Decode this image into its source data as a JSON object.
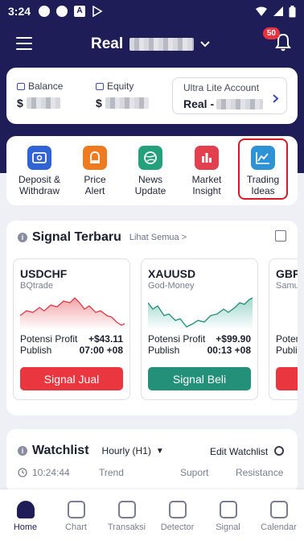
{
  "status_bar": {
    "time": "3:24"
  },
  "header": {
    "account_type": "Real",
    "notification_count": "50"
  },
  "balance": {
    "balance_label": "Balance",
    "balance_currency": "$",
    "equity_label": "Equity",
    "equity_currency": "$",
    "account_box_title": "Ultra Lite Account",
    "account_box_value": "Real -"
  },
  "menu": [
    {
      "label1": "Deposit &",
      "label2": "Withdraw",
      "icon": "wallet-icon",
      "color": "#2f63d6"
    },
    {
      "label1": "Price",
      "label2": "Alert",
      "icon": "alarm-icon",
      "color": "#f07a1f"
    },
    {
      "label1": "News",
      "label2": "Update",
      "icon": "globe-icon",
      "color": "#24a07a"
    },
    {
      "label1": "Market",
      "label2": "Insight",
      "icon": "bar-chart-icon",
      "color": "#e2404f"
    },
    {
      "label1": "Trading",
      "label2": "Ideas",
      "icon": "line-chart-icon",
      "color": "#2e93d6"
    }
  ],
  "signal": {
    "title": "Signal Terbaru",
    "see_all": "Lihat Semua >",
    "profit_label": "Potensi Profit",
    "publish_label": "Publish",
    "items": [
      {
        "pair": "USDCHF",
        "provider": "BQtrade",
        "profit": "+$43.11",
        "publish": "07:00 +08",
        "action": "Signal Jual",
        "color": "#e9363f"
      },
      {
        "pair": "XAUUSD",
        "provider": "God-Money",
        "profit": "+$99.90",
        "publish": "00:13 +08",
        "action": "Signal Beli",
        "color": "#23917a"
      },
      {
        "pair": "GBPJ",
        "provider": "Samu",
        "profit": "",
        "publish": "",
        "action": "",
        "color": "#e9363f"
      }
    ]
  },
  "watchlist": {
    "title": "Watchlist",
    "timeframe": "Hourly (H1)",
    "edit_label": "Edit Watchlist",
    "time": "10:24:44",
    "col_trend": "Trend",
    "col_support": "Suport",
    "col_resistance": "Resistance"
  },
  "bottom_nav": [
    {
      "label": "Home",
      "active": true
    },
    {
      "label": "Chart"
    },
    {
      "label": "Transaksi"
    },
    {
      "label": "Detector"
    },
    {
      "label": "Signal"
    },
    {
      "label": "Calendar"
    }
  ]
}
